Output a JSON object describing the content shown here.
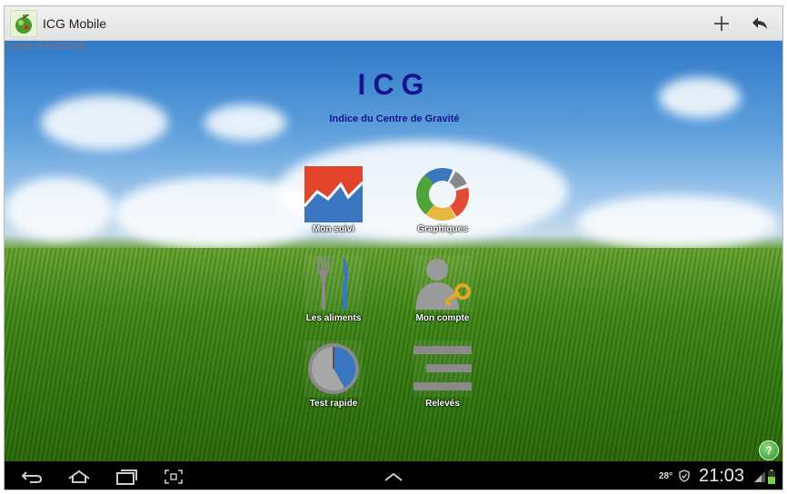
{
  "app": {
    "title": "ICG Mobile"
  },
  "user": {
    "name": "Joseph DJOGBEDE"
  },
  "header": {
    "title": "ICG",
    "subtitle": "Indice du Centre de Gravité"
  },
  "tiles": [
    {
      "label": "Mon suivi",
      "icon": "trend-chart-icon"
    },
    {
      "label": "Graphiques",
      "icon": "donut-chart-icon"
    },
    {
      "label": "Les aliments",
      "icon": "fork-knife-icon"
    },
    {
      "label": "Mon compte",
      "icon": "user-key-icon"
    },
    {
      "label": "Test rapide",
      "icon": "timer-icon"
    },
    {
      "label": "Relevés",
      "icon": "list-bars-icon"
    }
  ],
  "actionbar": {
    "add_icon": "plus-icon",
    "back_icon": "reply-arrow-icon"
  },
  "status": {
    "temperature": "28°",
    "time": "21:03"
  },
  "colors": {
    "title": "#14148c",
    "actionbar": "#ececec",
    "navbar": "#000000"
  }
}
